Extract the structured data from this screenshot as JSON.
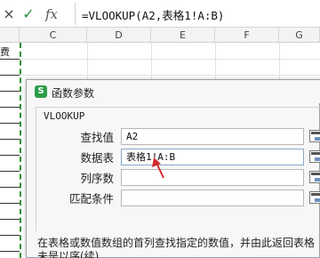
{
  "formula_bar": {
    "cancel_icon": "×",
    "confirm_icon": "✓",
    "fx_label": "fx",
    "formula": "=VLOOKUP(A2,表格1!A:B)"
  },
  "columns": [
    "C",
    "D",
    "E",
    "F",
    "G"
  ],
  "sheet": {
    "b_header_fragment": "费"
  },
  "dialog": {
    "title": "函数参数",
    "logo": "S",
    "function_name": "VLOOKUP",
    "args": [
      {
        "label": "查找值",
        "value": "A2"
      },
      {
        "label": "数据表",
        "value": "表格1!A:B"
      },
      {
        "label": "列序数",
        "value": ""
      },
      {
        "label": "匹配条件",
        "value": ""
      }
    ],
    "description_line1": "在表格或数值数组的首列查找指定的数值，并由此返回表格",
    "description_line2": "未是以序(续)"
  },
  "colors": {
    "marquee": "#2f8f2f",
    "arrow": "#d22d2d",
    "logo": "#2b9d47"
  }
}
